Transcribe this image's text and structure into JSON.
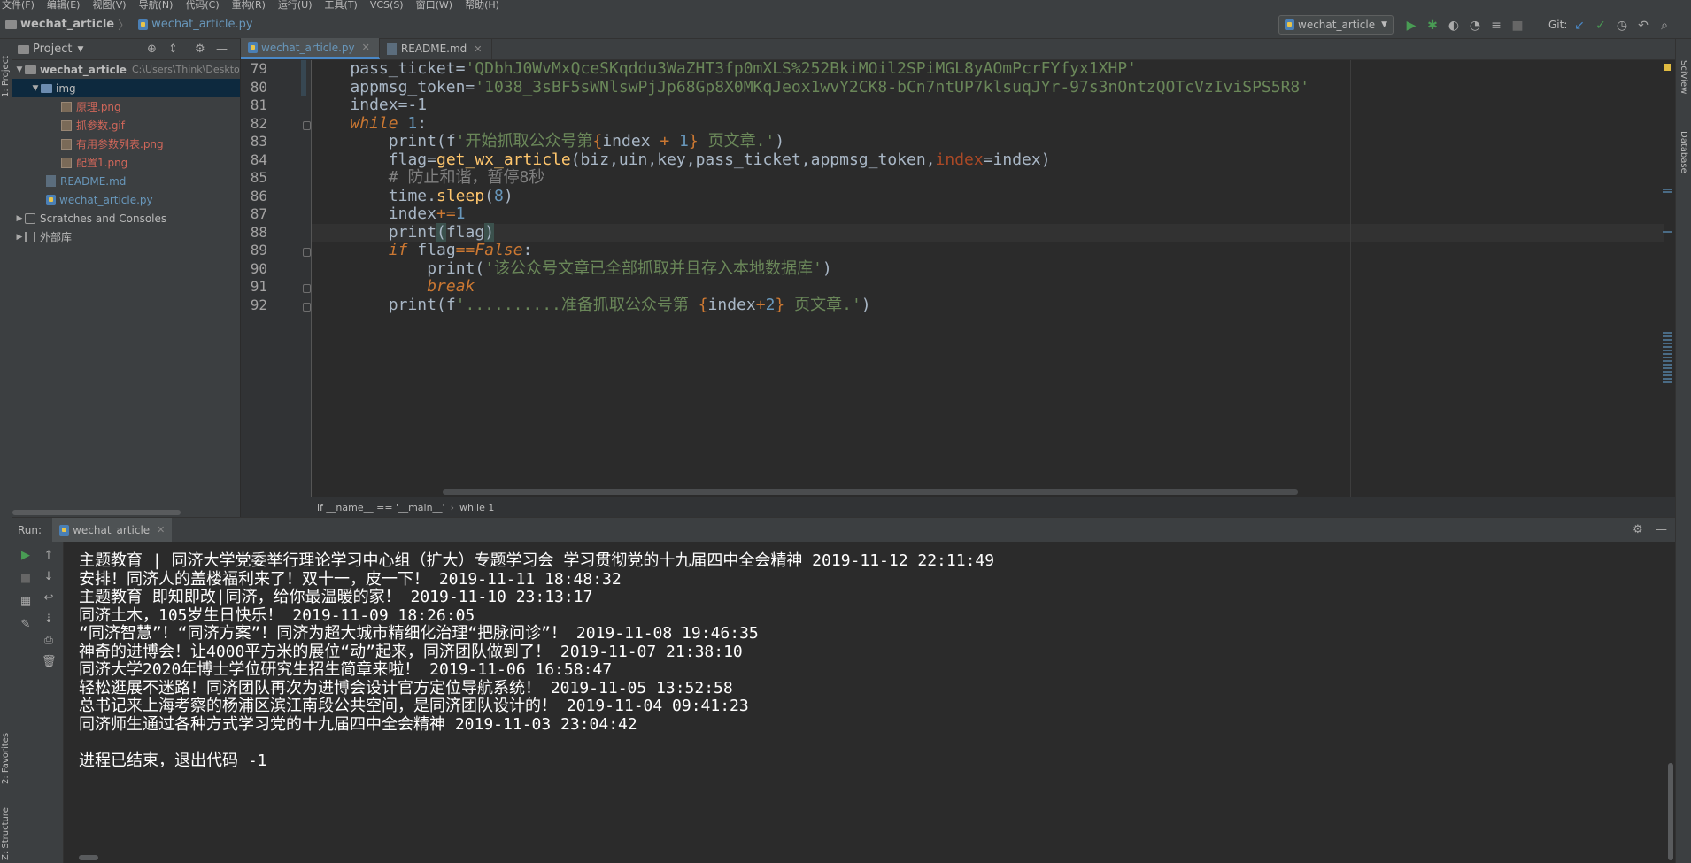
{
  "menu": [
    "文件(F)",
    "编辑(E)",
    "视图(V)",
    "导航(N)",
    "代码(C)",
    "重构(R)",
    "运行(U)",
    "工具(T)",
    "VCS(S)",
    "窗口(W)",
    "帮助(H)"
  ],
  "navbar": {
    "project": "wechat_article",
    "file": "wechat_article.py",
    "run_config": "wechat_article",
    "git_label": "Git:"
  },
  "project_panel": {
    "title": "Project",
    "stripe_label": "1: Project",
    "items": [
      {
        "label": "wechat_article",
        "path": "C:\\Users\\Think\\Deskto"
      },
      {
        "label": "img"
      },
      {
        "label": "原理.png"
      },
      {
        "label": "抓参数.gif"
      },
      {
        "label": "有用参数列表.png"
      },
      {
        "label": "配置1.png"
      },
      {
        "label": "README.md"
      },
      {
        "label": "wechat_article.py"
      },
      {
        "label": "Scratches and Consoles"
      },
      {
        "label": "外部库"
      }
    ]
  },
  "tabs": [
    {
      "label": "wechat_article.py",
      "active": true
    },
    {
      "label": "README.md",
      "active": false
    }
  ],
  "editor": {
    "current_line": 88,
    "lines": [
      {
        "no": "79",
        "pre": "pass_ticket=",
        "str": "'QDbhJ0WvMxQceSKqddu3WaZHT3fp0mXLS%252BkiMOil2SPiMGL8yAOmPcrFYfyx1XHP'"
      },
      {
        "no": "80",
        "pre": "appmsg_token=",
        "str": "'1038_3sBF5sWNlswPjJp68Gp8X0MKqJeox1wvY2CK8-bCn7ntUP7klsuqJYr-97s3nOntzQOTcVzIviSPS5R8'"
      },
      {
        "no": "81",
        "a": "index=",
        "b": "-1"
      },
      {
        "no": "82",
        "kw": "while",
        "num": " 1",
        "rest": ":"
      },
      {
        "no": "83",
        "a": "print(f",
        "s1": "'开始抓取公众号第",
        "b1": "{",
        "v": "index ",
        "op": "+",
        "n": " 1",
        "b2": "}",
        "s2": " 页文章.'",
        "c": ")"
      },
      {
        "no": "84",
        "a": "flag=",
        "fn": "get_wx_article",
        "b": "(biz,uin,key,pass_ticket,appmsg_token,",
        "p": "index",
        "c": "=index)"
      },
      {
        "no": "85",
        "cmt": "# 防止和谐，暂停8秒"
      },
      {
        "no": "86",
        "a": "time.",
        "fn": "sleep",
        "b": "(",
        "n": "8",
        "c": ")"
      },
      {
        "no": "87",
        "a": "index",
        "op": "+=",
        "n": "1"
      },
      {
        "no": "88",
        "a": "print",
        "h1": "(",
        "b": "flag",
        "h2": ")"
      },
      {
        "no": "89",
        "kw": "if",
        "a": " flag",
        "op": "==",
        "kw2": "False",
        "c": ":"
      },
      {
        "no": "90",
        "a": "print(",
        "s": "'该公众号文章已全部抓取并且存入本地数据库'",
        "c": ")"
      },
      {
        "no": "91",
        "kw": "break"
      },
      {
        "no": "92",
        "a": "print(f",
        "s1": "'..........准备抓取公众号第 ",
        "b1": "{",
        "v": "index",
        "op": "+",
        "n": "2",
        "b2": "}",
        "s2": " 页文章.'",
        "c": ")"
      }
    ]
  },
  "breadcrumb": [
    "if __name__ == '__main__'",
    "while 1"
  ],
  "run": {
    "label": "Run:",
    "tab": "wechat_article",
    "output": [
      "主题教育 | 同济大学党委举行理论学习中心组（扩大）专题学习会 学习贯彻党的十九届四中全会精神 2019-11-12 22:11:49",
      "安排！同济人的盖楼福利来了！双十一，皮一下！ 2019-11-11 18:48:32",
      "主题教育 即知即改|同济，给你最温暖的家！ 2019-11-10 23:13:17",
      "同济土木，105岁生日快乐！ 2019-11-09 18:26:05",
      "“同济智慧”！“同济方案”！同济为超大城市精细化治理“把脉问诊”！ 2019-11-08 19:46:35",
      "神奇的进博会！让4000平方米的展位“动”起来，同济团队做到了！ 2019-11-07 21:38:10",
      "同济大学2020年博士学位研究生招生简章来啦！ 2019-11-06 16:58:47",
      "轻松逛展不迷路！同济团队再次为进博会设计官方定位导航系统！ 2019-11-05 13:52:58",
      "总书记来上海考察的杨浦区滨江南段公共空间，是同济团队设计的！ 2019-11-04 09:41:23",
      "同济师生通过各种方式学习党的十九届四中全会精神 2019-11-03 23:04:42",
      "",
      "进程已结束，退出代码 -1"
    ]
  },
  "side_labels": {
    "left_bottom_1": "2: Favorites",
    "left_bottom_2": "Z: Structure",
    "right_1": "SciView",
    "right_2": "Database"
  },
  "colors": {
    "string": "#6a8759",
    "keyword": "#cc7832",
    "number": "#6897bb",
    "function": "#ffc66d",
    "comment": "#808080",
    "param": "#aa4926",
    "run_green": "#499c54"
  }
}
